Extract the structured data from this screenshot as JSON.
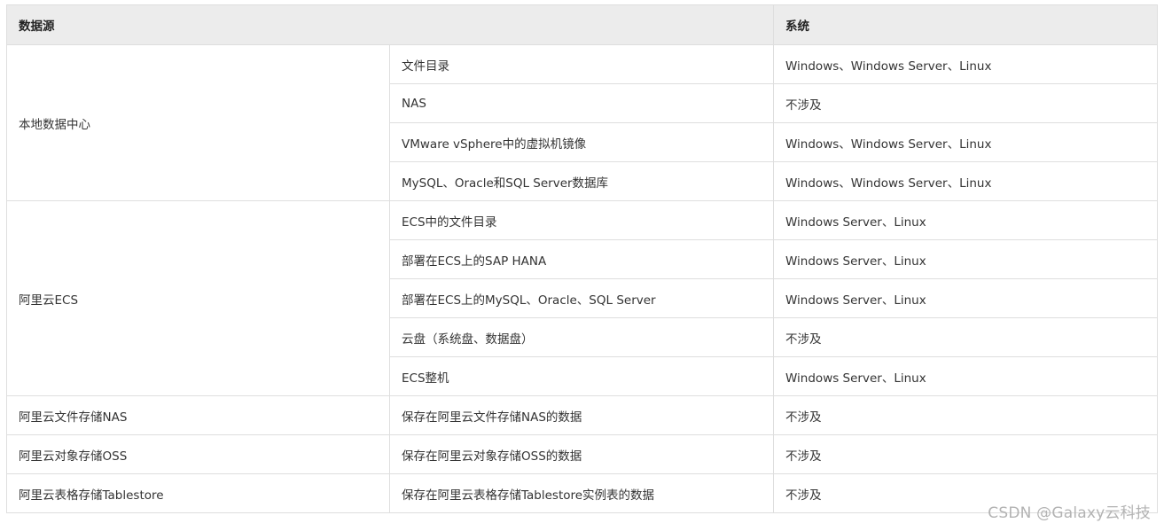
{
  "table": {
    "header": {
      "source": "数据源",
      "system": "系统"
    },
    "groups": [
      {
        "name": "本地数据中心",
        "rows": [
          {
            "item": "文件目录",
            "system": "Windows、Windows Server、Linux"
          },
          {
            "item": "NAS",
            "system": "不涉及"
          },
          {
            "item": "VMware vSphere中的虚拟机镜像",
            "system": "Windows、Windows Server、Linux"
          },
          {
            "item": "MySQL、Oracle和SQL Server数据库",
            "system": "Windows、Windows Server、Linux"
          }
        ]
      },
      {
        "name": "阿里云ECS",
        "rows": [
          {
            "item": "ECS中的文件目录",
            "system": "Windows Server、Linux"
          },
          {
            "item": "部署在ECS上的SAP HANA",
            "system": "Windows Server、Linux"
          },
          {
            "item": "部署在ECS上的MySQL、Oracle、SQL Server",
            "system": "Windows Server、Linux"
          },
          {
            "item": "云盘（系统盘、数据盘）",
            "system": "不涉及"
          },
          {
            "item": "ECS整机",
            "system": "Windows Server、Linux"
          }
        ]
      },
      {
        "name": "阿里云文件存储NAS",
        "rows": [
          {
            "item": "保存在阿里云文件存储NAS的数据",
            "system": "不涉及"
          }
        ]
      },
      {
        "name": "阿里云对象存储OSS",
        "rows": [
          {
            "item": "保存在阿里云对象存储OSS的数据",
            "system": "不涉及"
          }
        ]
      },
      {
        "name": "阿里云表格存储Tablestore",
        "rows": [
          {
            "item": "保存在阿里云表格存储Tablestore实例表的数据",
            "system": "不涉及"
          }
        ]
      }
    ]
  },
  "watermark": "CSDN @Galaxy云科技"
}
